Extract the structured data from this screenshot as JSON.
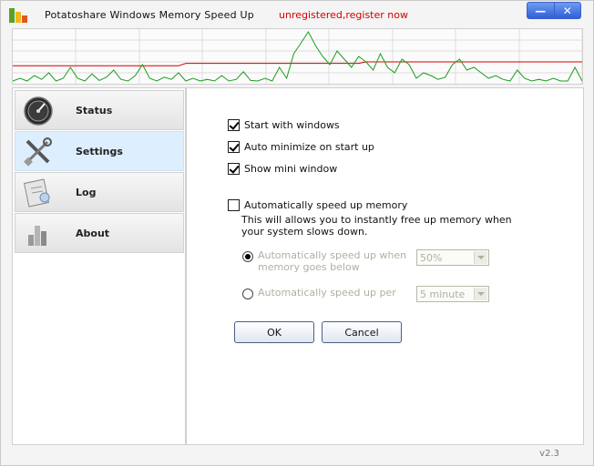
{
  "window": {
    "title": "Potatoshare Windows Memory Speed Up",
    "register_link": "unregistered,register now",
    "minimize_glyph": "—",
    "close_glyph": "✕",
    "icons": {
      "logo": "potatoshare-logo",
      "minimize": "minimize-icon",
      "close": "close-icon"
    }
  },
  "graph": {
    "description_colors": {
      "memory_line": "#d40000",
      "activity": "#1e9c1e",
      "gridline": "#dcdcdc"
    },
    "memory_series": [
      0.42,
      0.42,
      0.42,
      0.42,
      0.42,
      0.42,
      0.42,
      0.42,
      0.42,
      0.42,
      0.42,
      0.42,
      0.42,
      0.42,
      0.42,
      0.42,
      0.42,
      0.42,
      0.42,
      0.42,
      0.42,
      0.42,
      0.42,
      0.42,
      0.47,
      0.47,
      0.47,
      0.47,
      0.47,
      0.47,
      0.47,
      0.47,
      0.47,
      0.47,
      0.47,
      0.47,
      0.47,
      0.47,
      0.47,
      0.47,
      0.47,
      0.47,
      0.47,
      0.47,
      0.47,
      0.47,
      0.47,
      0.47,
      0.47,
      0.5,
      0.5,
      0.5,
      0.5,
      0.5,
      0.5,
      0.5,
      0.5,
      0.5,
      0.5,
      0.5,
      0.5,
      0.5,
      0.5,
      0.5,
      0.5,
      0.5,
      0.5,
      0.5,
      0.5,
      0.5,
      0.5,
      0.5,
      0.5,
      0.5,
      0.5,
      0.5,
      0.5,
      0.5,
      0.5,
      0.5
    ],
    "activity_series": [
      0.05,
      0.1,
      0.05,
      0.15,
      0.08,
      0.2,
      0.05,
      0.1,
      0.3,
      0.1,
      0.05,
      0.18,
      0.06,
      0.12,
      0.25,
      0.08,
      0.05,
      0.15,
      0.35,
      0.1,
      0.05,
      0.12,
      0.08,
      0.2,
      0.05,
      0.1,
      0.05,
      0.08,
      0.05,
      0.15,
      0.05,
      0.08,
      0.22,
      0.06,
      0.05,
      0.1,
      0.05,
      0.3,
      0.1,
      0.55,
      0.75,
      0.95,
      0.7,
      0.5,
      0.35,
      0.6,
      0.45,
      0.3,
      0.5,
      0.4,
      0.25,
      0.55,
      0.3,
      0.2,
      0.45,
      0.35,
      0.1,
      0.2,
      0.15,
      0.08,
      0.12,
      0.35,
      0.45,
      0.25,
      0.3,
      0.2,
      0.1,
      0.15,
      0.08,
      0.05,
      0.25,
      0.1,
      0.05,
      0.08,
      0.05,
      0.1,
      0.05,
      0.05,
      0.3,
      0.05
    ]
  },
  "nav": {
    "items": [
      {
        "label": "Status",
        "icon": "gauge-icon",
        "active": false
      },
      {
        "label": "Settings",
        "icon": "tools-icon",
        "active": true
      },
      {
        "label": "Log",
        "icon": "log-icon",
        "active": false
      },
      {
        "label": "About",
        "icon": "about-icon",
        "active": false
      }
    ]
  },
  "settings": {
    "start_with_windows": {
      "label": "Start with windows",
      "checked": true
    },
    "auto_minimize": {
      "label": "Auto minimize on start up",
      "checked": true
    },
    "show_mini_window": {
      "label": "Show mini window",
      "checked": true
    },
    "auto_speed_up": {
      "label": "Automatically speed up memory",
      "checked": false,
      "description": "This will allows you to instantly free up memory when your system slows down."
    },
    "radio_below": {
      "label": "Automatically speed up when memory goes below",
      "selected_value": "50%",
      "checked": true
    },
    "radio_per": {
      "label": "Automatically speed up per",
      "selected_value": "5 minute",
      "checked": false
    },
    "ok_label": "OK",
    "cancel_label": "Cancel"
  },
  "footer": {
    "version": "v2.3"
  }
}
